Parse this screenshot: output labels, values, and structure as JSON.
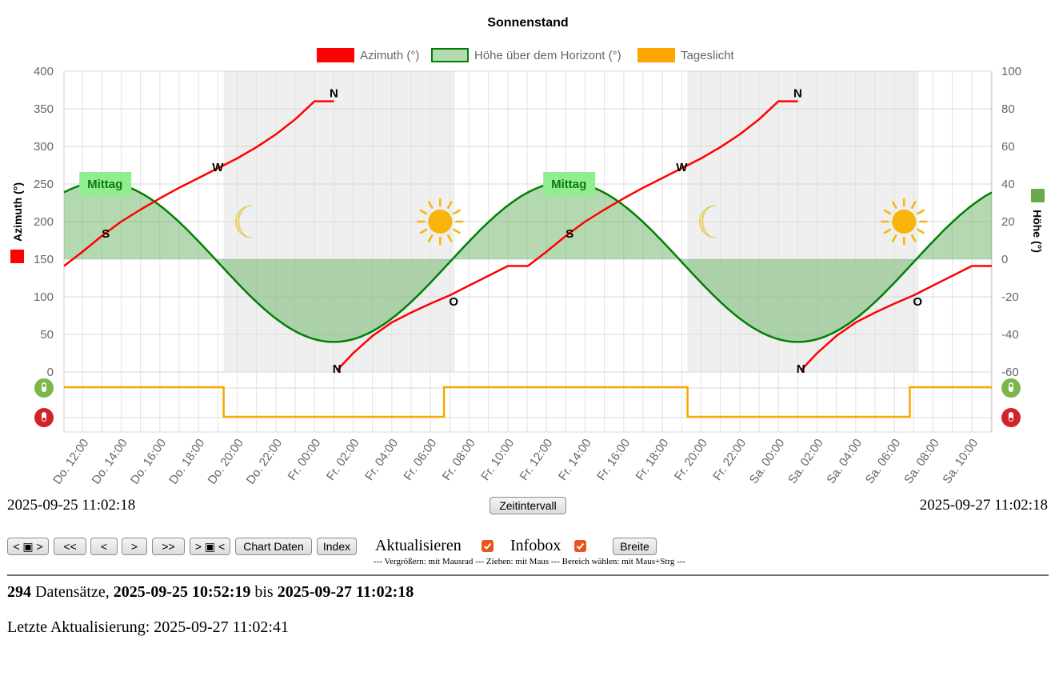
{
  "chart_data": {
    "type": "line",
    "title": "Sonnenstand",
    "legend": [
      {
        "label": "Azimuth (°)",
        "color": "#ff0000",
        "fill": "#ff0000"
      },
      {
        "label": "Höhe über dem Horizont (°)",
        "color": "#008000",
        "fill": "#b3dbb1"
      },
      {
        "label": "Tageslicht",
        "color": "#ffa500",
        "fill": "#ffa500"
      }
    ],
    "y_left": {
      "label": "Azimuth (°)",
      "min": 0,
      "max": 400,
      "ticks": [
        "0",
        "50",
        "100",
        "150",
        "200",
        "250",
        "300",
        "350",
        "400"
      ]
    },
    "y_right": {
      "label": "Höhe (°)",
      "min": -60,
      "max": 100,
      "ticks": [
        "-60",
        "-40",
        "-20",
        "0",
        "20",
        "40",
        "60",
        "80",
        "100"
      ]
    },
    "x_range": [
      "2025-09-25 11:02:18",
      "2025-09-27 11:02:18"
    ],
    "x_ticks": [
      "Do. 12:00",
      "Do. 14:00",
      "Do. 16:00",
      "Do. 18:00",
      "Do. 20:00",
      "Do. 22:00",
      "Fr. 00:00",
      "Fr. 02:00",
      "Fr. 04:00",
      "Fr. 06:00",
      "Fr. 08:00",
      "Fr. 10:00",
      "Fr. 12:00",
      "Fr. 14:00",
      "Fr. 16:00",
      "Fr. 18:00",
      "Fr. 20:00",
      "Fr. 22:00",
      "Sa. 00:00",
      "Sa. 02:00",
      "Sa. 04:00",
      "Sa. 06:00",
      "Sa. 08:00",
      "Sa. 10:00"
    ],
    "x_tick_hours": [
      12,
      14,
      16,
      18,
      20,
      22,
      24,
      26,
      28,
      30,
      32,
      34,
      36,
      38,
      40,
      42,
      44,
      46,
      48,
      50,
      52,
      54,
      56,
      58
    ],
    "series": [
      {
        "name": "Azimuth (°)",
        "axis": "left",
        "segments": [
          {
            "x_hours": [
              11.04,
              12,
              13,
              14,
              15,
              16,
              17,
              18,
              19,
              20,
              21,
              22,
              23,
              24,
              25.0
            ],
            "y": [
              141,
              160,
              181,
              200,
              216,
              231,
              245,
              258,
              271,
              284,
              299,
              316,
              336,
              360,
              360
            ]
          },
          {
            "x_hours": [
              25.16,
              26,
              27,
              28,
              29,
              30,
              31,
              32,
              33,
              34,
              35.04
            ],
            "y": [
              2,
              25,
              48,
              66,
              79,
              91,
              102,
              115,
              128,
              141,
              141
            ]
          },
          {
            "x_hours": [
              35.04,
              36,
              37,
              38,
              39,
              40,
              41,
              42,
              43,
              44,
              45,
              46,
              47,
              48,
              49.0
            ],
            "y": [
              141,
              160,
              181,
              200,
              216,
              231,
              245,
              258,
              271,
              284,
              299,
              316,
              336,
              360,
              360
            ]
          },
          {
            "x_hours": [
              49.16,
              50,
              51,
              52,
              53,
              54,
              55,
              56,
              57,
              58,
              59.04
            ],
            "y": [
              2,
              25,
              48,
              66,
              79,
              91,
              102,
              115,
              128,
              141,
              141
            ]
          }
        ]
      },
      {
        "name": "Höhe über dem Horizont (°)",
        "axis": "right",
        "amplitude": 42.5,
        "offset": -1.5,
        "noon_hours": [
          13.0,
          37.0
        ],
        "period_hours": 24
      },
      {
        "name": "Tageslicht",
        "axis": "daylight",
        "on_off": [
          {
            "from": 11.04,
            "to": 19.3,
            "state": 1
          },
          {
            "from": 19.3,
            "to": 30.7,
            "state": 0
          },
          {
            "from": 30.7,
            "to": 43.3,
            "state": 1
          },
          {
            "from": 43.3,
            "to": 54.8,
            "state": 0
          },
          {
            "from": 54.8,
            "to": 59.04,
            "state": 1
          }
        ]
      }
    ],
    "night_bands": [
      [
        19.3,
        31.25
      ],
      [
        43.3,
        55.25
      ]
    ],
    "annotations": [
      {
        "text": "Mittag",
        "x_hour": 13.2,
        "type": "noon"
      },
      {
        "text": "Mittag",
        "x_hour": 37.2,
        "type": "noon"
      },
      {
        "text": "S",
        "x_hour": 13.2,
        "y": 180,
        "type": "dir"
      },
      {
        "text": "W",
        "x_hour": 19.0,
        "y": 271,
        "type": "dir"
      },
      {
        "text": "N",
        "x_hour": 25.0,
        "y": 360,
        "type": "dir"
      },
      {
        "text": "N",
        "x_hour": 25.16,
        "y": 2,
        "type": "dir"
      },
      {
        "text": "O",
        "x_hour": 31.2,
        "y": 92,
        "type": "dir"
      },
      {
        "text": "S",
        "x_hour": 37.2,
        "y": 180,
        "type": "dir"
      },
      {
        "text": "W",
        "x_hour": 43.0,
        "y": 271,
        "type": "dir"
      },
      {
        "text": "N",
        "x_hour": 49.0,
        "y": 360,
        "type": "dir"
      },
      {
        "text": "N",
        "x_hour": 49.16,
        "y": 2,
        "type": "dir"
      },
      {
        "text": "O",
        "x_hour": 55.2,
        "y": 92,
        "type": "dir"
      }
    ],
    "moon_icons": [
      20.5,
      44.5
    ],
    "sun_icons": [
      30.5,
      54.5
    ],
    "grid": true
  },
  "range": {
    "start": "2025-09-25 11:02:18",
    "end": "2025-09-27 11:02:18"
  },
  "buttons": {
    "zoom_out": "< ▣ >",
    "back_big": "<<",
    "back": "<",
    "forward": ">",
    "forward_big": ">>",
    "zoom_in": "> ▣ <",
    "chart_data": "Chart Daten",
    "index": "Index",
    "interval": "Zeitintervall",
    "width": "Breite"
  },
  "options": {
    "refresh": "Aktualisieren",
    "infobox": "Infobox"
  },
  "hint": "--- Vergrößern: mit Mausrad --- Ziehen: mit Maus --- Bereich wählen: mit Maus+Strg ---",
  "summary": {
    "count": "294",
    "label": "Datensätze,",
    "from": "2025-09-25 10:52:19",
    "to_word": "bis",
    "to": "2025-09-27 11:02:18"
  },
  "updated": {
    "label": "Letzte Aktualisierung:",
    "value": "2025-09-27 11:02:41"
  }
}
